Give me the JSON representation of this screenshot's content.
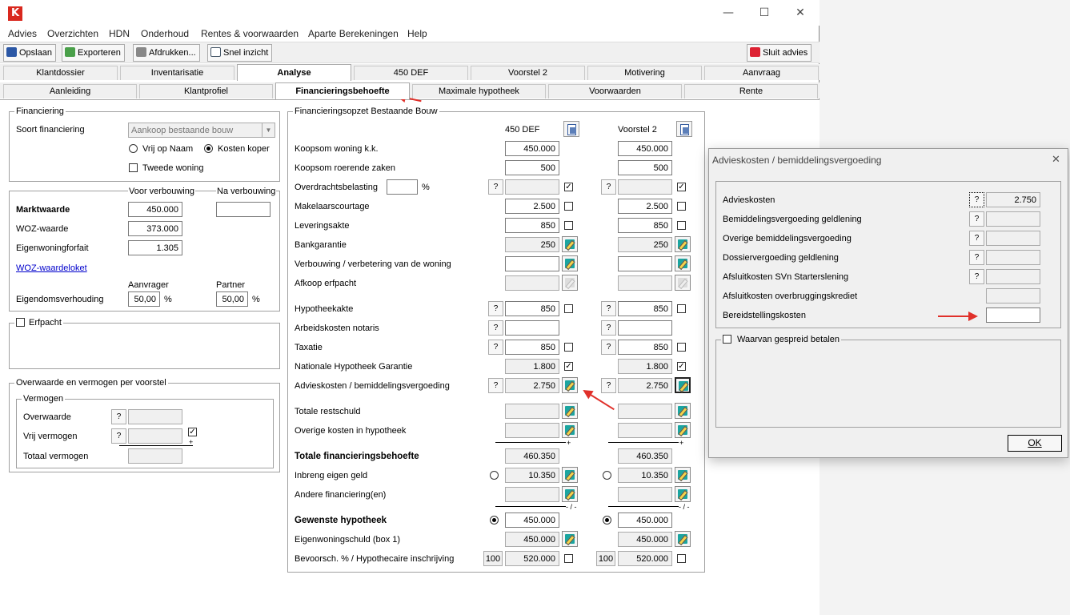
{
  "window": {
    "logo": "K",
    "minimize": "—",
    "maximize": "☐",
    "close": "✕"
  },
  "menu": [
    "Advies",
    "Overzichten",
    "HDN",
    "Onderhoud",
    "Rentes & voorwaarden",
    "Aparte Berekeningen",
    "Help"
  ],
  "toolbar": {
    "save": "Opslaan",
    "export": "Exporteren",
    "print": "Afdrukken...",
    "quick": "Snel inzicht",
    "close_advice": "Sluit advies"
  },
  "tabs1": [
    "Klantdossier",
    "Inventarisatie",
    "Analyse",
    "450 DEF",
    "Voorstel 2",
    "Motivering",
    "Aanvraag"
  ],
  "tabs2": [
    "Aanleiding",
    "Klantprofiel",
    "Financieringsbehoefte",
    "Maximale hypotheek",
    "Voorwaarden",
    "Rente"
  ],
  "financiering": {
    "legend": "Financiering",
    "soort_label": "Soort financiering",
    "soort_value": "Aankoop bestaande bouw",
    "von": "Vrij op Naam",
    "kk": "Kosten koper",
    "tweede": "Tweede woning"
  },
  "waarde": {
    "voor": "Voor verbouwing",
    "na": "Na verbouwing",
    "markt": "Marktwaarde",
    "markt_val": "450.000",
    "woz": "WOZ-waarde",
    "woz_val": "373.000",
    "ewf": "Eigenwoningforfait",
    "ewf_val": "1.305",
    "link": "WOZ-waardeloket",
    "aanvrager": "Aanvrager",
    "partner": "Partner",
    "eig": "Eigendomsverhouding",
    "eig_a": "50,00",
    "eig_p": "50,00",
    "pct": "%"
  },
  "erfpacht": "Erfpacht",
  "overwaarde": {
    "legend": "Overwaarde en vermogen per voorstel",
    "vermogen": "Vermogen",
    "ow": "Overwaarde",
    "vv": "Vrij vermogen",
    "tv": "Totaal vermogen",
    "q": "?",
    "plus": "+"
  },
  "opzet": {
    "legend": "Financieringsopzet Bestaande Bouw",
    "col1": "450 DEF",
    "col2": "Voorstel 2",
    "q": "?",
    "pct": "%",
    "plus": "+",
    "minus": "- / -",
    "rows": {
      "koopsom": "Koopsom woning k.k.",
      "roerend": "Koopsom roerende zaken",
      "overdracht": "Overdrachtsbelasting",
      "makelaar": "Makelaarscourtage",
      "levering": "Leveringsakte",
      "bankgarantie": "Bankgarantie",
      "verbouwing": "Verbouwing / verbetering van de woning",
      "afkoop": "Afkoop erfpacht",
      "hypotheekakte": "Hypotheekakte",
      "arbeid": "Arbeidskosten notaris",
      "taxatie": "Taxatie",
      "nhg": "Nationale Hypotheek Garantie",
      "advies": "Advieskosten / bemiddelingsvergoeding",
      "restschuld": "Totale restschuld",
      "overige": "Overige kosten in hypotheek",
      "totaal": "Totale financieringsbehoefte",
      "inbreng": "Inbreng eigen geld",
      "andere": "Andere financiering(en)",
      "gewenst": "Gewenste hypotheek",
      "ews": "Eigenwoningschuld (box 1)",
      "bevoorsch": "Bevoorsch. % / Hypothecaire inschrijving"
    },
    "v1": {
      "koopsom": "450.000",
      "roerend": "500",
      "makelaar": "2.500",
      "levering": "850",
      "bankgarantie": "250",
      "hypotheekakte": "850",
      "taxatie": "850",
      "nhg": "1.800",
      "advies": "2.750",
      "totaal": "460.350",
      "inbreng": "10.350",
      "gewenst": "450.000",
      "ews": "450.000",
      "pct": "100",
      "inschr": "520.000"
    },
    "v2": {
      "koopsom": "450.000",
      "roerend": "500",
      "makelaar": "2.500",
      "levering": "850",
      "bankgarantie": "250",
      "hypotheekakte": "850",
      "taxatie": "850",
      "nhg": "1.800",
      "advies": "2.750",
      "totaal": "460.350",
      "inbreng": "10.350",
      "gewenst": "450.000",
      "ews": "450.000",
      "pct": "100",
      "inschr": "520.000"
    }
  },
  "dialog": {
    "title": "Advieskosten / bemiddelingsvergoeding",
    "close": "✕",
    "q": "?",
    "ok": "OK",
    "spread": "Waarvan gespreid betalen",
    "rows": [
      "Advieskosten",
      "Bemiddelingsvergoeding geldlening",
      "Overige bemiddelingsvergoeding",
      "Dossiervergoeding geldlening",
      "Afsluitkosten SVn Starterslening",
      "Afsluitkosten overbruggingskrediet",
      "Bereidstellingskosten"
    ],
    "advies_val": "2.750"
  },
  "colors": {
    "accent_red": "#e0302a",
    "edit_icon": "#1ba5a0",
    "logo": "#d9281e"
  }
}
